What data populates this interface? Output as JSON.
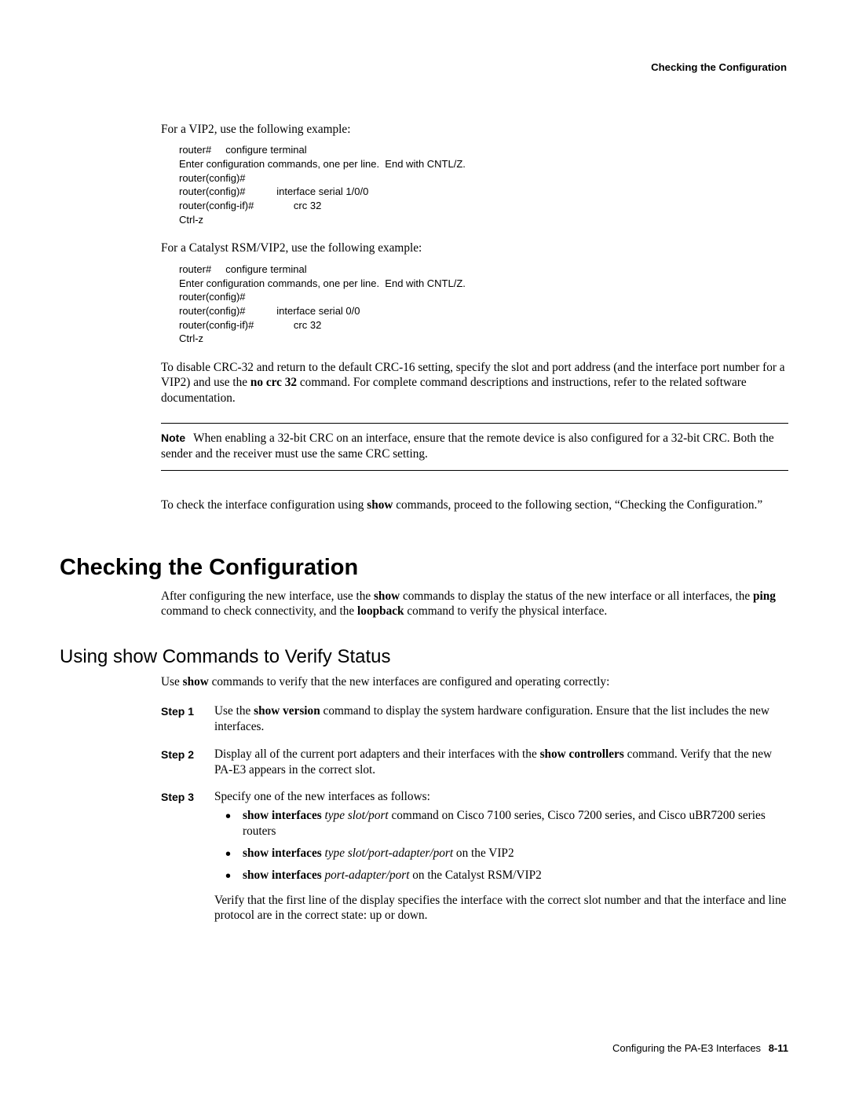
{
  "header": {
    "running": "Checking the Configuration"
  },
  "intro": {
    "vip2_lead": "For a VIP2, use the following example:",
    "vip2_code": "router#     configure terminal\nEnter configuration commands, one per line.  End with CNTL/Z.\nrouter(config)#\nrouter(config)#           interface serial 1/0/0\nrouter(config-if)#              crc 32\nCtrl-z",
    "catalyst_lead": "For a Catalyst RSM/VIP2, use the following example:",
    "catalyst_code": "router#     configure terminal\nEnter configuration commands, one per line.  End with CNTL/Z.\nrouter(config)#\nrouter(config)#           interface serial 0/0\nrouter(config-if)#              crc 32\nCtrl-z",
    "disable_p1": "To disable CRC-32 and return to the default CRC-16 setting, specify the slot and port address (and the interface port number for a VIP2) and use the ",
    "disable_cmd": "no crc 32",
    "disable_p2": " command. For complete command descriptions and instructions, refer to the related software documentation.",
    "note_label": "Note",
    "note_text": "When enabling a 32-bit CRC on an interface, ensure that the remote device is also configured for a 32-bit CRC. Both the sender and the receiver must use the same CRC setting.",
    "check_p1": "To check the interface configuration using ",
    "check_cmd": "show",
    "check_p2": " commands, proceed to the following section, “Checking the Configuration.”"
  },
  "section": {
    "h2": "Checking the Configuration",
    "after_p1": "After configuring the new interface, use the ",
    "after_b1": "show",
    "after_p2": " commands to display the status of the new interface or all interfaces, the ",
    "after_b2": "ping",
    "after_p3": " command to check connectivity, and the ",
    "after_b3": "loopback",
    "after_p4": " command to verify the physical interface."
  },
  "sub": {
    "h3": "Using show Commands to Verify Status",
    "lead_p1": "Use ",
    "lead_b1": "show",
    "lead_p2": " commands to verify that the new interfaces are configured and operating correctly:",
    "steps": [
      {
        "label": "Step 1",
        "pre": "Use the ",
        "bold": "show version",
        "post": " command to display the system hardware configuration. Ensure that the list includes the new interfaces."
      },
      {
        "label": "Step 2",
        "pre": "Display all of the current port adapters and their interfaces with the ",
        "bold": "show controllers",
        "post": " command. Verify that the new PA-E3 appears in the correct slot."
      },
      {
        "label": "Step 3",
        "pre": "Specify one of the new interfaces as follows:",
        "bold": "",
        "post": ""
      }
    ],
    "bullets": [
      {
        "b": "show interfaces",
        "it": " type slot/port",
        "rest": " command on Cisco 7100 series, Cisco 7200 series, and Cisco uBR7200 series routers"
      },
      {
        "b": "show interfaces",
        "it": " type slot/port-adapter/port",
        "rest": " on the VIP2"
      },
      {
        "b": "show interfaces",
        "it": " port-adapter/port",
        "rest": " on the Catalyst RSM/VIP2"
      }
    ],
    "verify": "Verify that the first line of the display specifies the interface with the correct slot number and that the interface and line protocol are in the correct state: up or down."
  },
  "footer": {
    "chapter": "Configuring the PA-E3 Interfaces",
    "page": "8-11"
  }
}
